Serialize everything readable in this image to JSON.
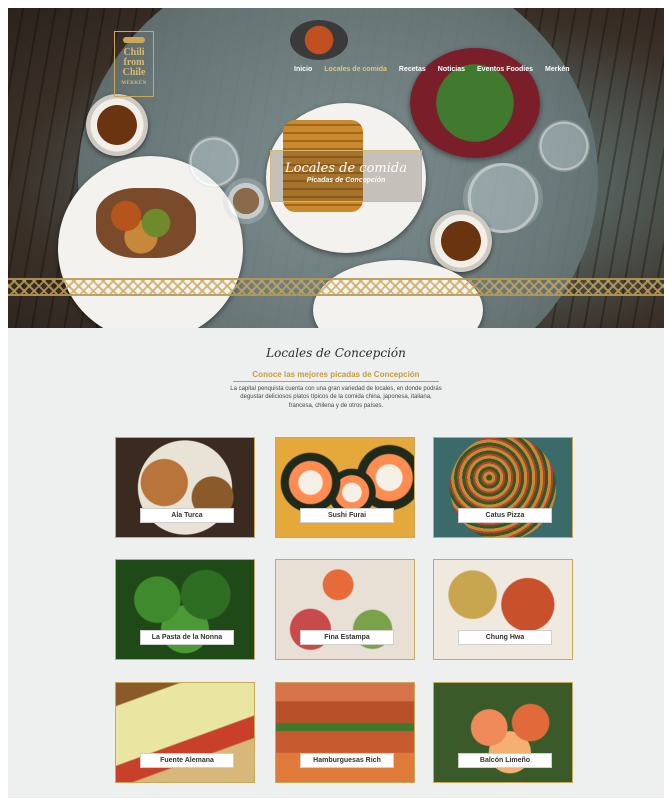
{
  "brand": {
    "name": "Chili from Chile",
    "line1": "Chili",
    "line2": "from",
    "line3": "Chile",
    "tagline": "MERKÉN"
  },
  "nav": {
    "items": [
      "Inicio",
      "Locales de comida",
      "Recetas",
      "Noticias",
      "Eventos Foodies",
      "Merkén"
    ],
    "active_index": 1
  },
  "hero": {
    "title": "Locales de comida",
    "subtitle": "Picadas de Concepción"
  },
  "section": {
    "title": "Locales de Concepción",
    "subtitle": "Conoce las mejores picadas de Concepción",
    "intro": "La capital penquista cuenta con una gran variedad de locales, en donde podrás degustar deliciosos platos típicos de la comida china, japonesa, italiana, francesa, chilena y de otros países."
  },
  "restaurants": [
    {
      "name": "Ala Turca",
      "icon": "kebab-photo"
    },
    {
      "name": "Sushi Furai",
      "icon": "sushi-photo"
    },
    {
      "name": "Catus Pizza",
      "icon": "pizza-photo"
    },
    {
      "name": "La Pasta de la Nonna",
      "icon": "pasta-photo"
    },
    {
      "name": "Fina Estampa",
      "icon": "seafood-platter-photo"
    },
    {
      "name": "Chung Hwa",
      "icon": "chinese-food-photo"
    },
    {
      "name": "Fuente Alemana",
      "icon": "sandwich-photo"
    },
    {
      "name": "Hamburguesas Rich",
      "icon": "hamburger-photo"
    },
    {
      "name": "Balcón Limeño",
      "icon": "shrimp-dish-photo"
    }
  ],
  "colors": {
    "gold": "#c69b3c",
    "accent_nav": "#e0c77d",
    "background": "#eef0ef"
  }
}
